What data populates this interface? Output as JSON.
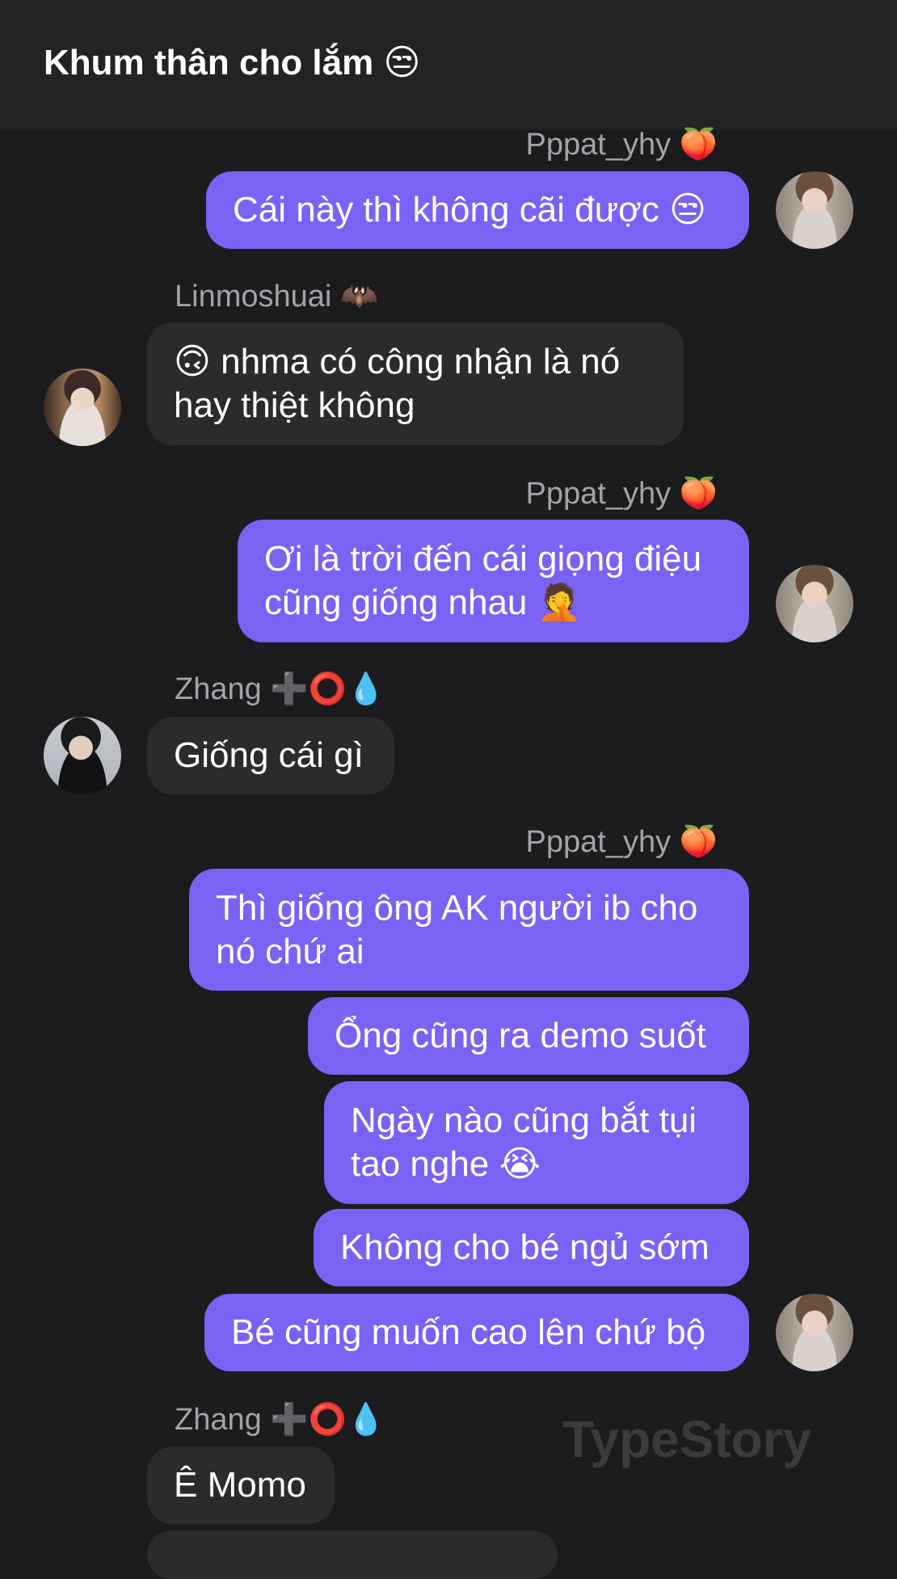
{
  "header": {
    "title": "Khum thân cho lắm",
    "title_emoji": "😒"
  },
  "senders": {
    "pppat": {
      "name": "Pppat_yhy",
      "emoji": "🍑"
    },
    "lin": {
      "name": "Linmoshuai",
      "emoji": "🦇"
    },
    "zhang": {
      "name": "Zhang",
      "emoji": "➕⭕💧"
    }
  },
  "messages": {
    "m1": {
      "text": "Cái này thì không cãi được",
      "emoji": "😒"
    },
    "m2": {
      "emoji": "🙃",
      "text": " nhma có công nhận là nó hay thiệt không"
    },
    "m3": {
      "text": "Ơi là trời đến cái giọng điệu cũng giống nhau",
      "emoji": "🤦"
    },
    "m4": {
      "text": "Giống cái gì"
    },
    "m5": {
      "text": "Thì giống ông AK người ib cho nó chứ ai"
    },
    "m6": {
      "text": "Ổng cũng ra demo suốt"
    },
    "m7": {
      "text": "Ngày nào cũng bắt tụi tao nghe",
      "emoji": "😭"
    },
    "m8": {
      "text": "Không cho bé ngủ sớm"
    },
    "m9": {
      "text": "Bé cũng muốn cao lên chứ bộ"
    },
    "m10": {
      "text": "Ê Momo"
    }
  },
  "watermark": "TypeStory",
  "colors": {
    "outgoing": "#7b61f4",
    "incoming": "#2b2b2e",
    "background": "#1c1c1e",
    "header": "#232325"
  }
}
